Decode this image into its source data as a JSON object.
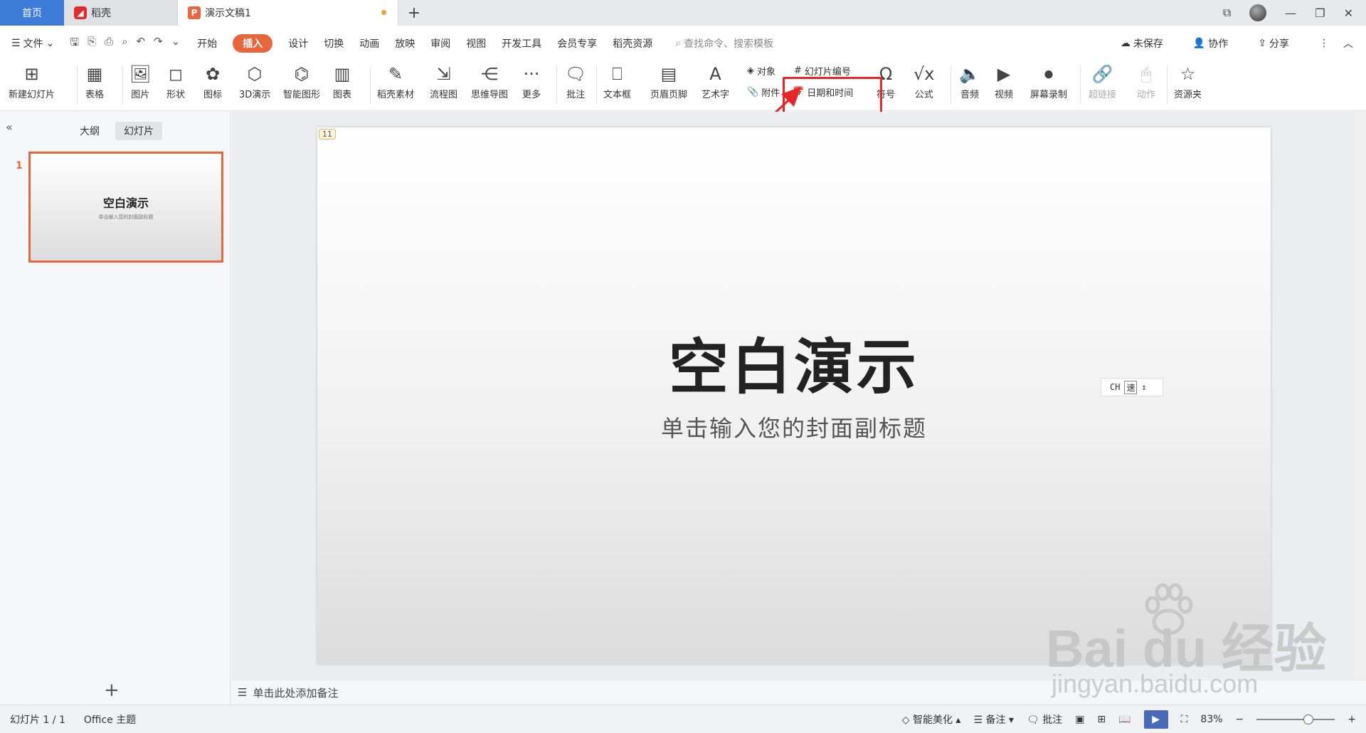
{
  "tabs": {
    "home": "首页",
    "docer": "稻壳",
    "doc": "演示文稿1"
  },
  "menu": {
    "file": "文件",
    "items": [
      "开始",
      "插入",
      "设计",
      "切换",
      "动画",
      "放映",
      "审阅",
      "视图",
      "开发工具",
      "会员专享",
      "稻壳资源"
    ],
    "active": "插入",
    "search_placeholder": "查找命令、搜索模板",
    "unsaved": "未保存",
    "collab": "协作",
    "share": "分享"
  },
  "ribbon": {
    "new_slide": "新建幻灯片",
    "table": "表格",
    "picture": "图片",
    "shape": "形状",
    "icon": "图标",
    "threed": "3D演示",
    "smart_shape": "智能图形",
    "chart": "图表",
    "docer_material": "稻壳素材",
    "flowchart": "流程图",
    "mindmap": "思维导图",
    "more": "更多",
    "comment": "批注",
    "textbox": "文本框",
    "header_footer": "页眉页脚",
    "wordart": "艺术字",
    "object": "对象",
    "attachment": "附件",
    "slide_number": "幻灯片编号",
    "datetime": "日期和时间",
    "symbol": "符号",
    "formula": "公式",
    "audio": "音频",
    "video": "视频",
    "screen_record": "屏幕录制",
    "hyperlink": "超链接",
    "action": "动作",
    "resource": "资源夹"
  },
  "left_panel": {
    "outline_tab": "大纲",
    "slides_tab": "幻灯片",
    "slide_num": "1",
    "thumb_title": "空白演示",
    "thumb_sub": "单击输入您的封面副标题"
  },
  "slide": {
    "badge": "11",
    "title": "空白演示",
    "subtitle": "单击输入您的封面副标题"
  },
  "ime": {
    "lang": "CH",
    "mode": "速"
  },
  "notes": {
    "placeholder": "单击此处添加备注"
  },
  "status": {
    "slide_count": "幻灯片 1 / 1",
    "theme": "Office 主题",
    "beautify": "智能美化",
    "notes": "备注",
    "comments": "批注",
    "zoom": "83%"
  },
  "watermark": {
    "brand": "Bai  du 经验",
    "url": "jingyan.baidu.com"
  },
  "colors": {
    "accent": "#e8663c",
    "home_tab": "#3d7bd9",
    "highlight": "#e8262a"
  }
}
